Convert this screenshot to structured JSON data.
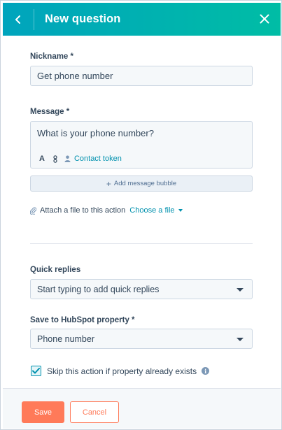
{
  "header": {
    "title": "New question",
    "back_icon": "chevron-left-icon",
    "close_icon": "close-icon",
    "gradient_start": "#00a4bd",
    "gradient_end": "#00bda5"
  },
  "nickname": {
    "label": "Nickname *",
    "value": "Get phone number"
  },
  "message": {
    "label": "Message *",
    "value": "What is your phone number?",
    "toolbar": {
      "format_label": "A",
      "contact_token_label": "Contact token"
    }
  },
  "add_bubble": {
    "label": "Add message bubble"
  },
  "attachment": {
    "label": "Attach a file to this action",
    "choose_label": "Choose a file"
  },
  "quick_replies": {
    "label": "Quick replies",
    "placeholder": "Start typing to add quick replies"
  },
  "property": {
    "label": "Save to HubSpot property *",
    "selected": "Phone number"
  },
  "skip": {
    "label": "Skip this action if property already exists",
    "checked": true,
    "info_icon": "info-icon"
  },
  "footer": {
    "save_label": "Save",
    "cancel_label": "Cancel",
    "accent_color": "#ff7a59"
  }
}
